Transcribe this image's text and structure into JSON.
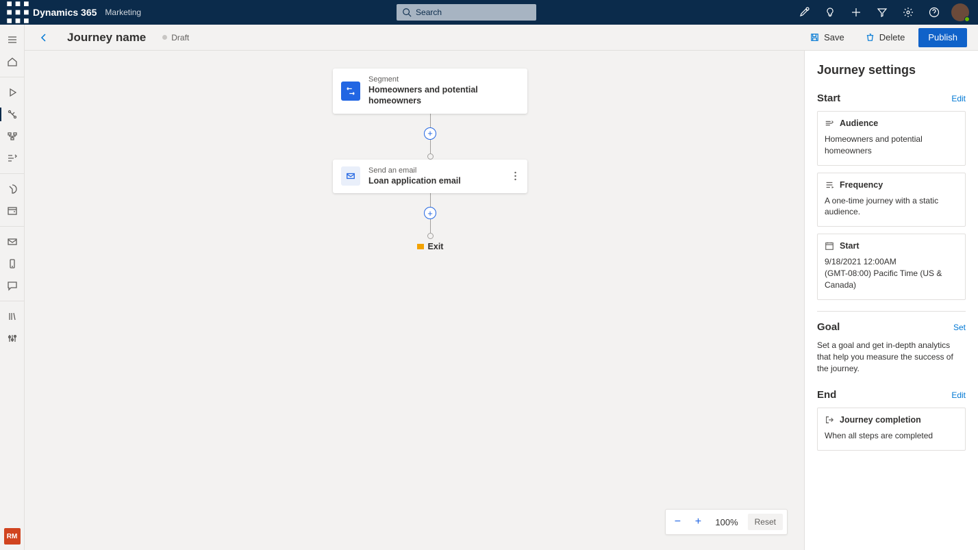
{
  "top": {
    "brand": "Dynamics 365",
    "module": "Marketing",
    "search_placeholder": "Search",
    "avatar_initials": ""
  },
  "leftnav": {
    "bottom_initials": "RM"
  },
  "header": {
    "title": "Journey name",
    "status": "Draft",
    "save": "Save",
    "delete": "Delete",
    "publish": "Publish"
  },
  "flow": {
    "segment_type": "Segment",
    "segment_name": "Homeowners and potential homeowners",
    "email_type": "Send an email",
    "email_name": "Loan application email",
    "exit": "Exit"
  },
  "zoom": {
    "value": "100%",
    "reset": "Reset"
  },
  "panel": {
    "title": "Journey settings",
    "start": {
      "heading": "Start",
      "edit": "Edit",
      "audience_label": "Audience",
      "audience_value": "Homeowners and potential homeowners",
      "frequency_label": "Frequency",
      "frequency_value": "A one-time journey with a static audience.",
      "start_label": "Start",
      "start_value_line1": "9/18/2021 12:00AM",
      "start_value_line2": "(GMT-08:00) Pacific Time (US & Canada)"
    },
    "goal": {
      "heading": "Goal",
      "set": "Set",
      "desc": "Set a goal and get in-depth analytics that help you measure the success of the journey."
    },
    "end": {
      "heading": "End",
      "edit": "Edit",
      "completion_label": "Journey completion",
      "completion_value": "When all steps are completed"
    }
  }
}
